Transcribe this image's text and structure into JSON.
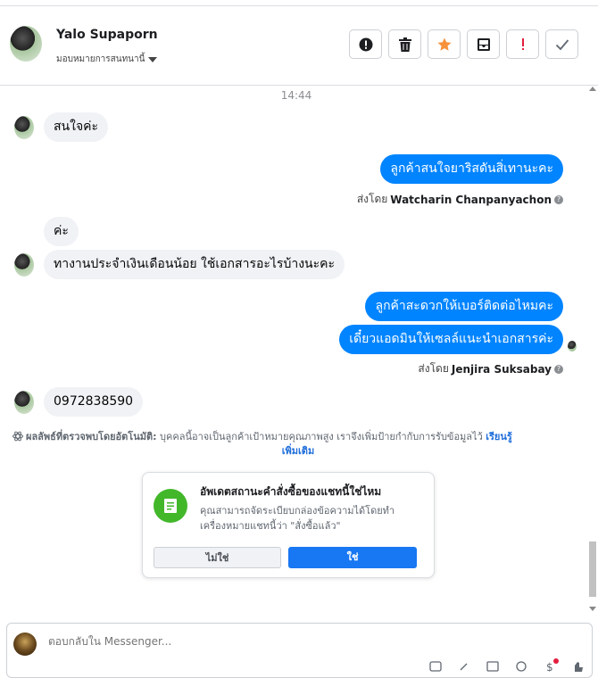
{
  "header": {
    "contact_name": "Yalo Supaporn",
    "assign_label": "มอบหมายการสนทนานี้"
  },
  "actions": [
    {
      "icon": "alert-circle-icon",
      "color": "#1c1e21"
    },
    {
      "icon": "trash-icon",
      "color": "#1c1e21"
    },
    {
      "icon": "star-icon",
      "color": "#f7923b"
    },
    {
      "icon": "archive-inbox-icon",
      "color": "#1c1e21"
    },
    {
      "icon": "exclamation-icon",
      "color": "#e41e3f"
    },
    {
      "icon": "checkmark-icon",
      "color": "#606770"
    }
  ],
  "conversation": {
    "timestamp": "14:44",
    "messages": [
      {
        "dir": "in",
        "text": "สนใจค่ะ"
      },
      {
        "dir": "out",
        "text": "ลูกค้าสนใจยาริสดันสิ่เทานะคะ"
      },
      {
        "dir": "in",
        "text": "ค่ะ"
      },
      {
        "dir": "in",
        "text": "ทางานประจำเงินเดือนน้อย ใช้เอกสารอะไรบ้างนะคะ"
      },
      {
        "dir": "out",
        "text": "ลูกค้าสะดวกให้เบอร์ติดต่อไหมคะ"
      },
      {
        "dir": "out",
        "text": "เดี๋ยวแอดมินให้เซลล์แนะนำเอกสารค่ะ"
      },
      {
        "dir": "in",
        "text": "0972838590"
      }
    ],
    "sent_by_prefix": "ส่งโดย",
    "sender_1": "Watcharin Chanpanyachon",
    "sender_2": "Jenjira Suksabay"
  },
  "auto_detect": {
    "label": "ผลลัพธ์ที่ตรวจพบโดยอัตโนมัติ:",
    "text": "บุคคลนี้อาจเป็นลูกค้าเป้าหมายคุณภาพสูง เราจึงเพิ่มป้ายกำกับการรับข้อมูลไว้",
    "link_1": "เรียนรู้",
    "link_2": "เพิ่มเติม"
  },
  "order_card": {
    "title": "อัพเดตสถานะคำสั่งซื้อของแชทนี้ใช่ไหม",
    "desc": "คุณสามารถจัดระเบียบกล่องข้อความได้โดยทำเครื่องหมายแชทนี้ว่า \"สั่งซื้อแล้ว\"",
    "no_label": "ไม่ใช่",
    "yes_label": "ใช่"
  },
  "composer": {
    "placeholder": "ตอบกลับใน Messenger..."
  },
  "colors": {
    "brand_blue": "#0084ff",
    "button_blue": "#1877f2",
    "success_green": "#42b72a"
  }
}
